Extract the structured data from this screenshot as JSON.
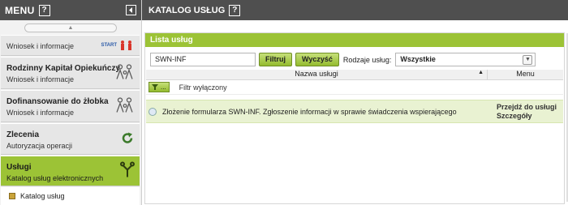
{
  "menu": {
    "title": "MENU",
    "help": "?",
    "items": [
      {
        "title": "",
        "subtitle": "Wniosek i informacje",
        "icon": "start-family-icon"
      },
      {
        "title": "Rodzinny Kapitał Opiekuńczy",
        "subtitle": "Wniosek i informacje",
        "icon": "family-icon"
      },
      {
        "title": "Dofinansowanie do żłobka",
        "subtitle": "Wniosek i informacje",
        "icon": "family-icon"
      },
      {
        "title": "Zlecenia",
        "subtitle": "Autoryzacja operacji",
        "icon": "refresh-icon"
      },
      {
        "title": "Usługi",
        "subtitle": "Katalog usług elektronicznych",
        "icon": "services-icon"
      }
    ],
    "sub_item": "Katalog usług",
    "start_badge": "START"
  },
  "catalog": {
    "title": "KATALOG USŁUG",
    "help": "?",
    "panel_title": "Lista usług",
    "search_value": "SWN-INF",
    "filter_btn": "Filtruj",
    "clear_btn": "Wyczyść",
    "type_label": "Rodzaje usług:",
    "type_value": "Wszystkie",
    "col_name": "Nazwa usługi",
    "col_menu": "Menu",
    "tool_btn": "...",
    "filter_state": "Filtr wyłączony",
    "rows": [
      {
        "name": "Złożenie formularza SWN-INF. Zgłoszenie informacji w sprawie świadczenia wspierającego",
        "menu1": "Przejdź do usługi",
        "menu2": "Szczegóły"
      }
    ]
  },
  "colors": {
    "accent": "#9cc336",
    "header": "#4f4f4f"
  }
}
